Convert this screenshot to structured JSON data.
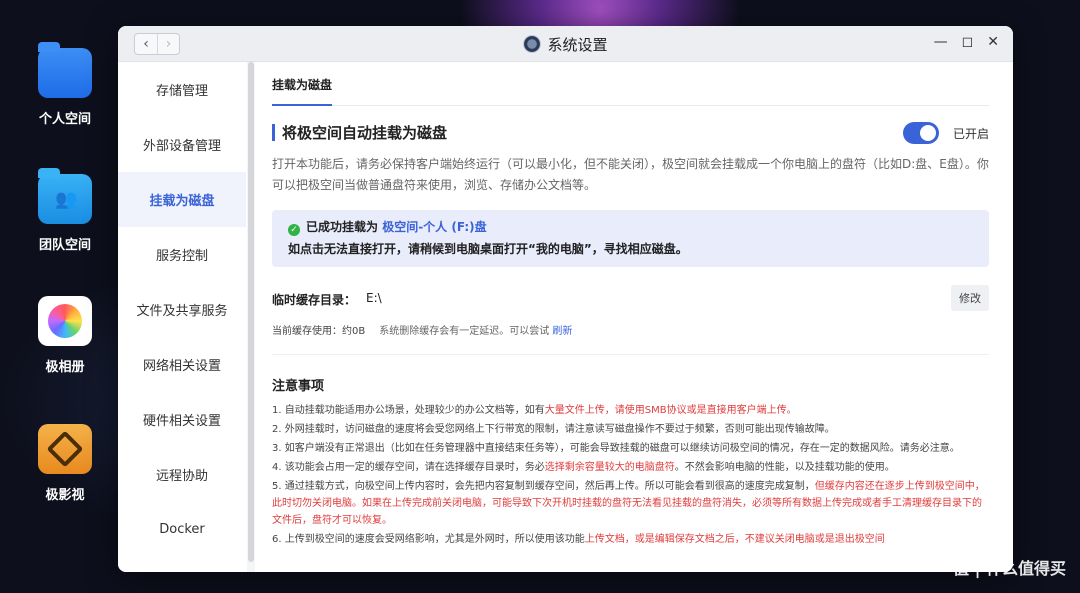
{
  "desktop": {
    "icons": [
      {
        "label": "个人空间",
        "icon": "folder-icon"
      },
      {
        "label": "团队空间",
        "icon": "team-folder-icon"
      },
      {
        "label": "极相册",
        "icon": "photos-icon"
      },
      {
        "label": "极影视",
        "icon": "video-icon"
      }
    ]
  },
  "window": {
    "title": "系统设置",
    "back": "‹",
    "forward": "›",
    "controls": {
      "minimize": "—",
      "maximize": "◻",
      "close": "✕"
    }
  },
  "sidebar": {
    "items": [
      {
        "label": "存储管理"
      },
      {
        "label": "外部设备管理"
      },
      {
        "label": "挂载为磁盘",
        "active": true
      },
      {
        "label": "服务控制"
      },
      {
        "label": "文件及共享服务"
      },
      {
        "label": "网络相关设置"
      },
      {
        "label": "硬件相关设置"
      },
      {
        "label": "远程协助"
      },
      {
        "label": "Docker"
      }
    ]
  },
  "main": {
    "tab": "挂载为磁盘",
    "section_title": "将极空间自动挂载为磁盘",
    "toggle_label": "已开启",
    "description": "打开本功能后，请务必保持客户端始终运行（可以最小化，但不能关闭），极空间就会挂载成一个你电脑上的盘符（比如D:盘、E盘）。你可以把极空间当做普通盘符来使用，浏览、存储办公文档等。",
    "notice": {
      "prefix": "已成功挂载为",
      "drive": "极空间-个人 (F:)盘",
      "line2": "如点击无法直接打开，请稍候到电脑桌面打开“我的电脑”，寻找相应磁盘。"
    },
    "cache": {
      "label": "临时缓存目录：",
      "value": "E:\\",
      "button": "修改",
      "usage": "当前缓存使用：约0B",
      "note": "系统删除缓存会有一定延迟。可以尝试",
      "refresh": "刷新"
    },
    "notes_title": "注意事项",
    "notes": {
      "n1a": "1. 自动挂载功能适用办公场景，处理较少的办公文档等，如有",
      "n1b": "大量文件上传，请使用SMB协议或是直接用客户端上传。",
      "n2": "2. 外网挂载时，访问磁盘的速度将会受您网络上下行带宽的限制，请注意读写磁盘操作不要过于频繁，否则可能出现传输故障。",
      "n3": "3. 如客户端没有正常退出（比如在任务管理器中直接结束任务等），可能会导致挂载的磁盘可以继续访问极空间的情况，存在一定的数据风险。请务必注意。",
      "n4a": "4. 该功能会占用一定的缓存空间，请在选择缓存目录时，务必",
      "n4b": "选择剩余容量较大的电脑盘符",
      "n4c": "。不然会影响电脑的性能，以及挂载功能的使用。",
      "n5a": "5. 通过挂载方式，向极空间上传内容时，会先把内容复制到缓存空间，然后再上传。所以可能会看到很高的速度完成复制，",
      "n5b": "但缓存内容还在逐步上传到极空间中，此时切勿关闭电脑。如果在上传完成前关闭电脑，可能导致下次开机时挂载的盘符无法看见挂载的盘符消失，必须等所有数据上传完成或者手工清理缓存目录下的文件后，盘符才可以恢复。",
      "n6a": "6. 上传到极空间的速度会受网络影响，尤其是外网时，所以使用该功能",
      "n6b": "上传文档，或是编辑保存文档之后，不建议关闭电脑或是退出极空间"
    }
  },
  "watermark": "值 | 什么值得买"
}
